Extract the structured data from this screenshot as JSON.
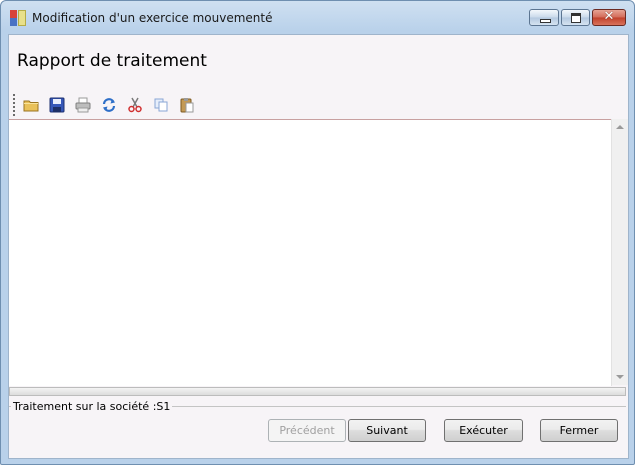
{
  "window": {
    "title": "Modification d'un exercice mouvementé",
    "controls": {
      "minimize_icon": "minimize-icon",
      "maximize_icon": "restore-icon",
      "close_glyph": "✕"
    }
  },
  "page": {
    "title": "Rapport de traitement"
  },
  "toolbar": {
    "items": [
      {
        "name": "open",
        "icon": "folder-icon"
      },
      {
        "name": "save",
        "icon": "save-icon"
      },
      {
        "name": "print",
        "icon": "print-icon"
      },
      {
        "name": "refresh",
        "icon": "refresh-icon"
      },
      {
        "name": "cut",
        "icon": "scissors-icon"
      },
      {
        "name": "copy",
        "icon": "copy-icon"
      },
      {
        "name": "paste",
        "icon": "paste-icon"
      }
    ]
  },
  "report": {
    "content": ""
  },
  "progress": {
    "fraction": 0
  },
  "status": {
    "label": "Traitement sur la société :S1"
  },
  "buttons": {
    "previous": "Précédent",
    "next": "Suivant",
    "execute": "Exécuter",
    "close": "Fermer"
  },
  "colors": {
    "accent": "#4ec23d",
    "titlebar": "#b9d1ea",
    "close": "#c0402b"
  }
}
